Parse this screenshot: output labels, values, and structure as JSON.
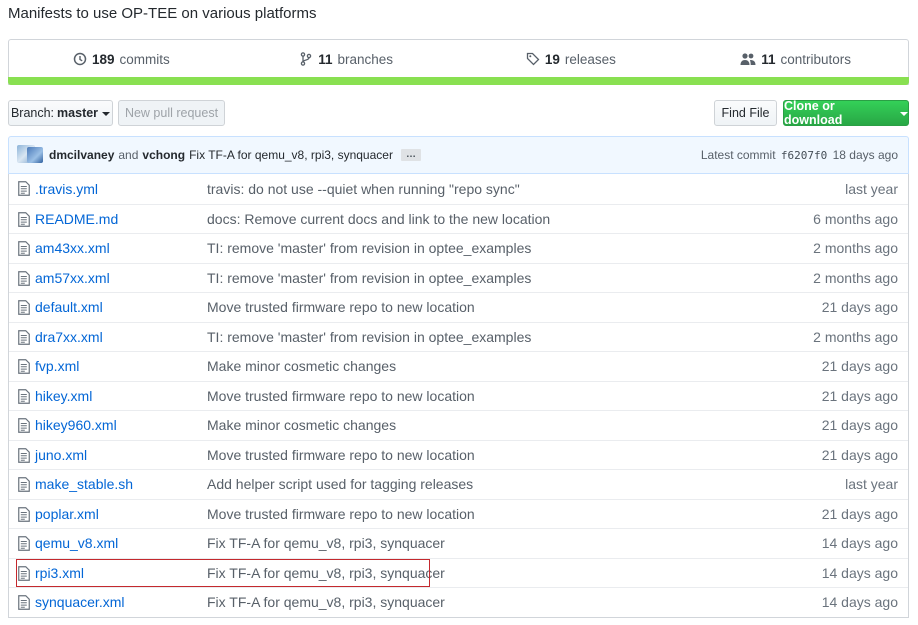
{
  "repo": {
    "description": "Manifests to use OP-TEE on various platforms"
  },
  "summary": {
    "commits": {
      "count": "189",
      "label": "commits"
    },
    "branches": {
      "count": "11",
      "label": "branches"
    },
    "releases": {
      "count": "19",
      "label": "releases"
    },
    "contributors": {
      "count": "11",
      "label": "contributors"
    },
    "language_bar_color": "#89e051"
  },
  "toolbar": {
    "branch_label": "Branch:",
    "branch_value": "master",
    "new_pull_request": "New pull request",
    "find_file": "Find File",
    "clone_or_download": "Clone or download"
  },
  "latest_commit": {
    "author1": "dmcilvaney",
    "and": "and",
    "author2": "vchong",
    "message": "Fix TF-A for qemu_v8, rpi3, synquacer",
    "ellipsis": "…",
    "latest_label": "Latest commit",
    "sha": "f6207f0",
    "age": "18 days ago"
  },
  "files": [
    {
      "name": ".travis.yml",
      "message": "travis: do not use --quiet when running \"repo sync\"",
      "age": "last year"
    },
    {
      "name": "README.md",
      "message": "docs: Remove current docs and link to the new location",
      "age": "6 months ago"
    },
    {
      "name": "am43xx.xml",
      "message": "TI: remove 'master' from revision in optee_examples",
      "age": "2 months ago"
    },
    {
      "name": "am57xx.xml",
      "message": "TI: remove 'master' from revision in optee_examples",
      "age": "2 months ago"
    },
    {
      "name": "default.xml",
      "message": "Move trusted firmware repo to new location",
      "age": "21 days ago"
    },
    {
      "name": "dra7xx.xml",
      "message": "TI: remove 'master' from revision in optee_examples",
      "age": "2 months ago"
    },
    {
      "name": "fvp.xml",
      "message": "Make minor cosmetic changes",
      "age": "21 days ago"
    },
    {
      "name": "hikey.xml",
      "message": "Move trusted firmware repo to new location",
      "age": "21 days ago"
    },
    {
      "name": "hikey960.xml",
      "message": "Make minor cosmetic changes",
      "age": "21 days ago"
    },
    {
      "name": "juno.xml",
      "message": "Move trusted firmware repo to new location",
      "age": "21 days ago"
    },
    {
      "name": "make_stable.sh",
      "message": "Add helper script used for tagging releases",
      "age": "last year"
    },
    {
      "name": "poplar.xml",
      "message": "Move trusted firmware repo to new location",
      "age": "21 days ago"
    },
    {
      "name": "qemu_v8.xml",
      "message": "Fix TF-A for qemu_v8, rpi3, synquacer",
      "age": "14 days ago"
    },
    {
      "name": "rpi3.xml",
      "message": "Fix TF-A for qemu_v8, rpi3, synquacer",
      "age": "14 days ago"
    },
    {
      "name": "synquacer.xml",
      "message": "Fix TF-A for qemu_v8, rpi3, synquacer",
      "age": "14 days ago"
    }
  ]
}
